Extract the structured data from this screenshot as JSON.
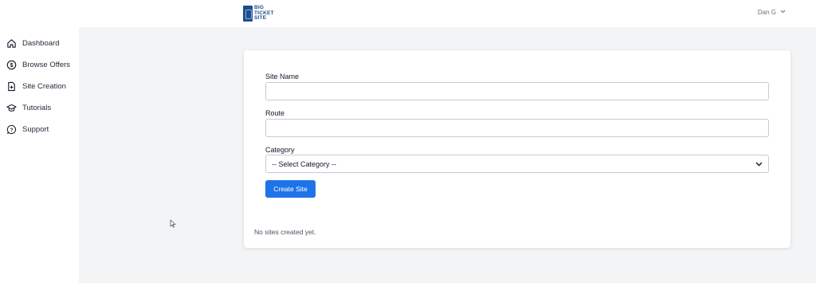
{
  "header": {
    "logo_lines": [
      "BIG",
      "TICKET",
      "SITE"
    ],
    "user_name": "Dan G",
    "user_menu_icon": "chevron-down-icon"
  },
  "sidebar": {
    "items": [
      {
        "label": "Dashboard",
        "icon": "home-icon"
      },
      {
        "label": "Browse Offers",
        "icon": "dollar-circle-icon"
      },
      {
        "label": "Site Creation",
        "icon": "file-plus-icon"
      },
      {
        "label": "Tutorials",
        "icon": "graduation-cap-icon"
      },
      {
        "label": "Support",
        "icon": "question-bubble-icon"
      }
    ]
  },
  "form": {
    "site_name_label": "Site Name",
    "site_name_value": "",
    "route_label": "Route",
    "route_value": "",
    "category_label": "Category",
    "category_selected": "-- Select Category --",
    "submit_label": "Create Site"
  },
  "sites": {
    "empty_message": "No sites created yet."
  },
  "colors": {
    "primary": "#1f73e8",
    "logo": "#1f4e8c",
    "background": "#f3f4f6"
  }
}
